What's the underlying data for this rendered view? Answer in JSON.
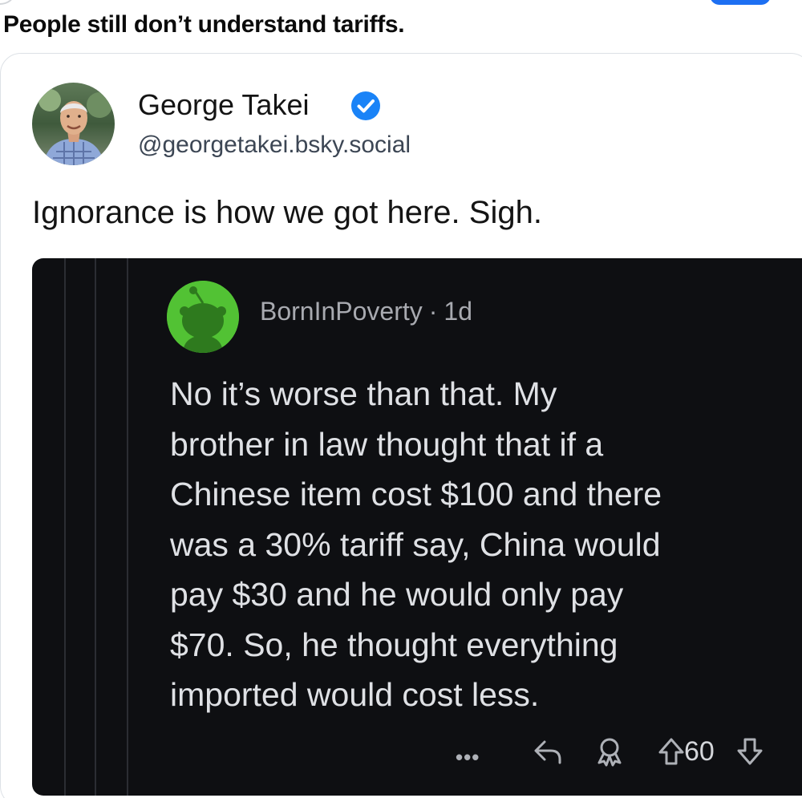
{
  "headline": "People still don’t understand tariffs.",
  "post": {
    "author_name": "George Takei",
    "author_handle": "@georgetakei.bsky.social",
    "text": "Ignorance is how we got here. Sigh.",
    "verified_icon": "verified-badge-icon"
  },
  "embedded_comment": {
    "username": "BornInPoverty",
    "separator": "·",
    "age": "1d",
    "body_lines": [
      "No it’s worse than that. My",
      "brother in law thought that if a",
      "Chinese item cost $100 and there",
      "was a 30% tariff say, China would",
      "pay $30 and he would only pay",
      "$70. So, he thought everything",
      "imported would cost less."
    ],
    "more_label": "•••",
    "vote_count": "60"
  },
  "colors": {
    "accent_blue": "#1d6ff2",
    "verified_blue": "#1a83f7",
    "reddit_avatar_green": "#52c234",
    "dark_card": "#0e0f12"
  }
}
